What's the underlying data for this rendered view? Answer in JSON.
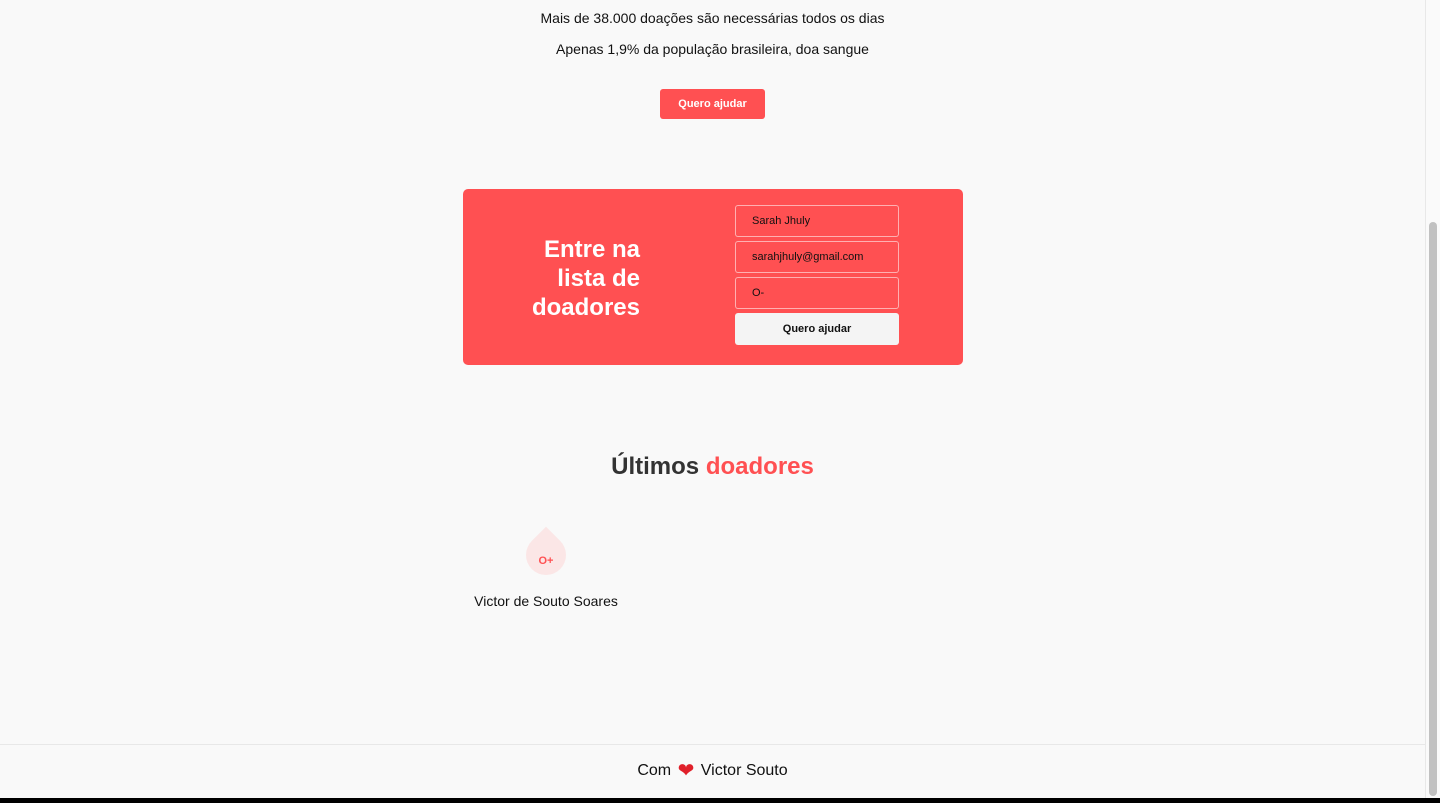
{
  "stats": {
    "line1": "Mais de 38.000 doações são necessárias todos os dias",
    "line2": "Apenas 1,9% da população brasileira, doa sangue"
  },
  "hero": {
    "button_label": "Quero ajudar"
  },
  "donor_form": {
    "title": "Entre na lista de doadores",
    "name_value": "Sarah Jhuly",
    "email_value": "sarahjhuly@gmail.com",
    "blood_value": "O-",
    "submit_label": "Quero ajudar"
  },
  "latest": {
    "title_part1": "Últimos",
    "title_part2": "doadores",
    "donors": [
      {
        "blood": "O+",
        "name": "Victor de Souto Soares"
      }
    ]
  },
  "footer": {
    "prefix": "Com",
    "heart_icon": "heart-icon",
    "author": "Victor Souto"
  },
  "colors": {
    "accent": "#ff5052",
    "background": "#f9f9f9"
  }
}
